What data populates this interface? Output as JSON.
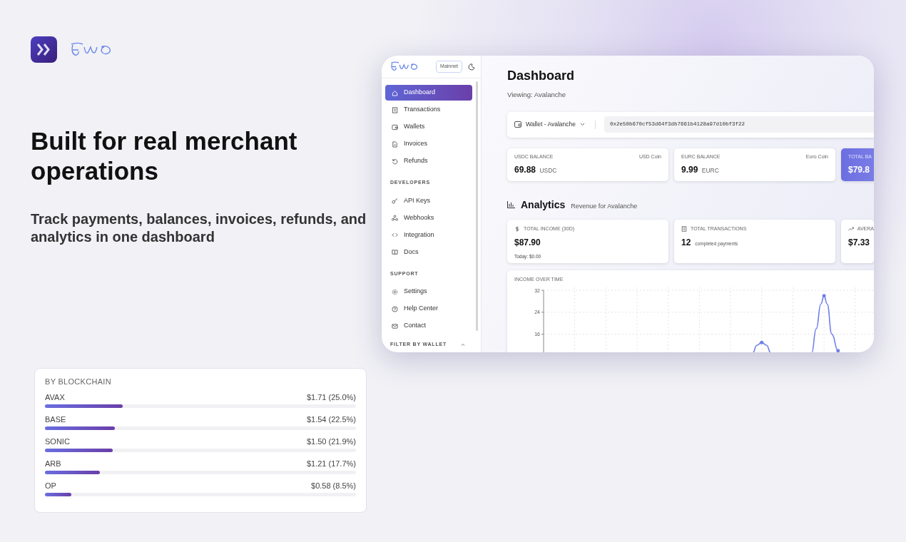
{
  "hero": {
    "title": "Built for real merchant operations",
    "subtitle": "Track payments, balances, invoices, refunds, and analytics in one dashboard"
  },
  "blockchain_card": {
    "title": "BY BLOCKCHAIN",
    "rows": [
      {
        "name": "AVAX",
        "amount": "$1.71 (25.0%)",
        "level": 0.25
      },
      {
        "name": "BASE",
        "amount": "$1.54 (22.5%)",
        "level": 0.225
      },
      {
        "name": "SONIC",
        "amount": "$1.50 (21.9%)",
        "level": 0.219
      },
      {
        "name": "ARB",
        "amount": "$1.21 (17.7%)",
        "level": 0.177
      },
      {
        "name": "OP",
        "amount": "$0.58 (8.5%)",
        "level": 0.085
      }
    ]
  },
  "dashboard": {
    "sidebar": {
      "network": "Mainnet",
      "sections": [
        {
          "items": [
            {
              "label": "Dashboard",
              "selected": true
            },
            {
              "label": "Transactions",
              "selected": false
            },
            {
              "label": "Wallets",
              "selected": false
            },
            {
              "label": "Invoices",
              "selected": false
            },
            {
              "label": "Refunds",
              "selected": false
            }
          ]
        },
        {
          "heading": "DEVELOPERS",
          "items": [
            {
              "label": "API Keys",
              "selected": false
            },
            {
              "label": "Webhooks",
              "selected": false
            },
            {
              "label": "Integration",
              "selected": false
            },
            {
              "label": "Docs",
              "selected": false
            }
          ]
        },
        {
          "heading": "SUPPORT",
          "items": [
            {
              "label": "Settings",
              "selected": false
            },
            {
              "label": "Help Center",
              "selected": false
            },
            {
              "label": "Contact",
              "selected": false
            }
          ]
        }
      ],
      "filter_heading": "FILTER BY WALLET"
    },
    "main": {
      "title": "Dashboard",
      "subtitle": "Viewing: Avalanche",
      "wallet": {
        "label": "Wallet - Avalanche",
        "address": "0x2e50b670cf53d64f3db7661b4128a97d10bf3f22"
      },
      "balances": [
        {
          "kind": "plain",
          "label": "USDC BALANCE",
          "note": "USD Coin",
          "amount": "69.88",
          "unit": "USDC"
        },
        {
          "kind": "plain",
          "label": "EURC BALANCE",
          "note": "Euro Coin",
          "amount": "9.99",
          "unit": "EURC"
        },
        {
          "kind": "highlight",
          "label": "TOTAL BA",
          "amount": "$79.8"
        }
      ],
      "analytics": {
        "title": "Analytics",
        "subtitle": "Revenue for Avalanche",
        "stats": [
          {
            "label": "TOTAL INCOME (30D)",
            "value": "$87.90",
            "detail": "Today: $0.00"
          },
          {
            "label": "TOTAL TRANSACTIONS",
            "value": "12",
            "unit": "completed payments"
          },
          {
            "label": "AVERA",
            "value": "$7.33"
          }
        ],
        "chart": {
          "title": "INCOME OVER TIME",
          "axis_labels": [
            "32",
            "24",
            "16"
          ]
        }
      }
    }
  }
}
